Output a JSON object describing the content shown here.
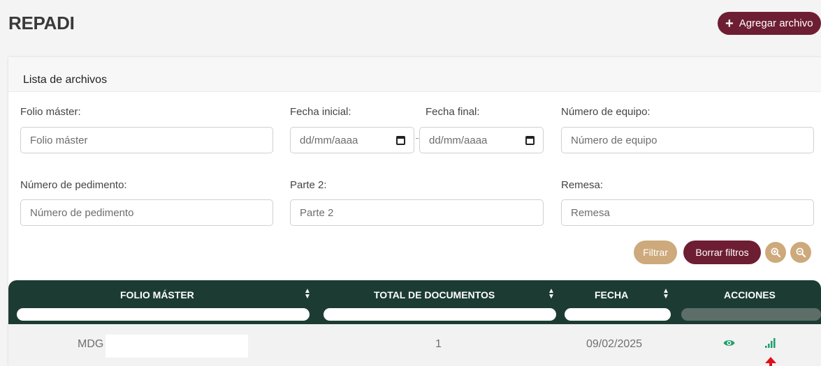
{
  "header": {
    "title": "REPADI",
    "add_button": {
      "icon": "plus-icon",
      "label": "Agregar archivo"
    }
  },
  "card": {
    "title": "Lista de archivos",
    "filters": {
      "folio": {
        "label": "Folio máster:",
        "placeholder": "Folio máster"
      },
      "fecha_inicial": {
        "label": "Fecha inicial:",
        "placeholder": "dd/mm/aaaa"
      },
      "fecha_final": {
        "label": "Fecha final:",
        "placeholder": "dd/mm/aaaa"
      },
      "equipo": {
        "label": "Número de equipo:",
        "placeholder": "Número de equipo"
      },
      "pedimento": {
        "label": "Número de pedimento:",
        "placeholder": "Número de pedimento"
      },
      "parte2": {
        "label": "Parte 2:",
        "placeholder": "Parte 2"
      },
      "remesa": {
        "label": "Remesa:",
        "placeholder": "Remesa"
      }
    },
    "buttons": {
      "filter": "Filtrar",
      "clear": "Borrar filtros",
      "zoom_in_icon": "zoom-in-icon",
      "zoom_out_icon": "zoom-out-icon"
    }
  },
  "table": {
    "columns": [
      "FOLIO MÁSTER",
      "TOTAL DE DOCUMENTOS",
      "FECHA",
      "ACCIONES"
    ],
    "rows": [
      {
        "folio": "MDG",
        "total": "1",
        "fecha": "09/02/2025",
        "actions": [
          "eye-icon",
          "signal-bars-icon"
        ]
      }
    ]
  },
  "colors": {
    "primary": "#6e1e32",
    "accent": "#cda97b",
    "table_header": "#1c3c33",
    "action_icon": "#1f9e6e",
    "annotation_arrow": "#e0101a"
  }
}
